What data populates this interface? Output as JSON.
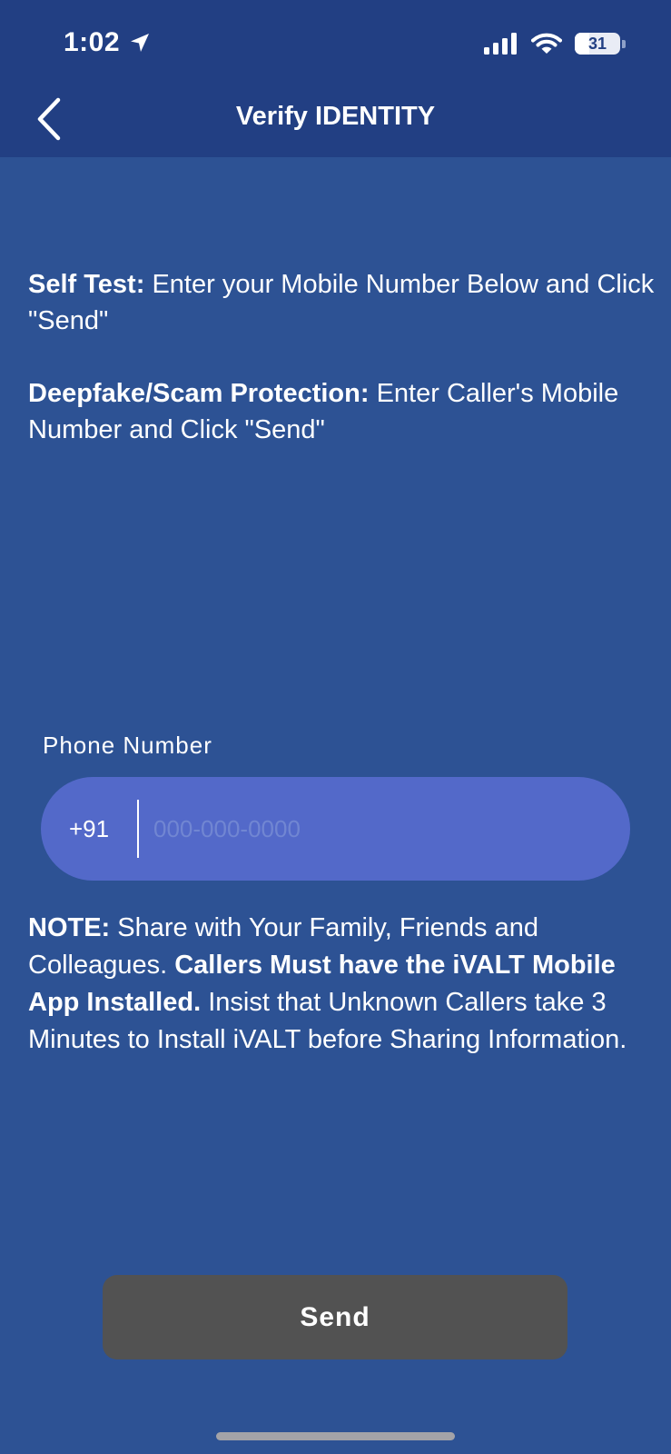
{
  "status_bar": {
    "time": "1:02",
    "battery_level": "31",
    "battery_fraction": 0.31,
    "location_icon": "location-arrow-icon",
    "signal_icon": "cellular-signal-icon",
    "wifi_icon": "wifi-icon"
  },
  "header": {
    "title": "Verify IDENTITY",
    "back_icon": "chevron-left-icon"
  },
  "instructions": {
    "self_test_label": "Self Test:",
    "self_test_text": " Enter your Mobile Number Below and Click \"Send\"",
    "deepfake_label": "Deepfake/Scam Protection:",
    "deepfake_text": " Enter Caller's Mobile Number and Click \"Send\""
  },
  "phone": {
    "label": "Phone Number",
    "country_code": "+91",
    "value": "",
    "placeholder": "000-000-0000"
  },
  "note": {
    "label": "NOTE:",
    "text1": " Share with Your Family, Friends and Colleagues. ",
    "bold_text": "Callers Must have the iVALT Mobile App Installed.",
    "text2": " Insist that Unknown Callers take 3 Minutes to Install iVALT before Sharing Information."
  },
  "actions": {
    "send_label": "Send"
  },
  "colors": {
    "background": "#2d5294",
    "header_background": "#223f83",
    "input_background": "#5369c9",
    "button_background": "#525252"
  }
}
